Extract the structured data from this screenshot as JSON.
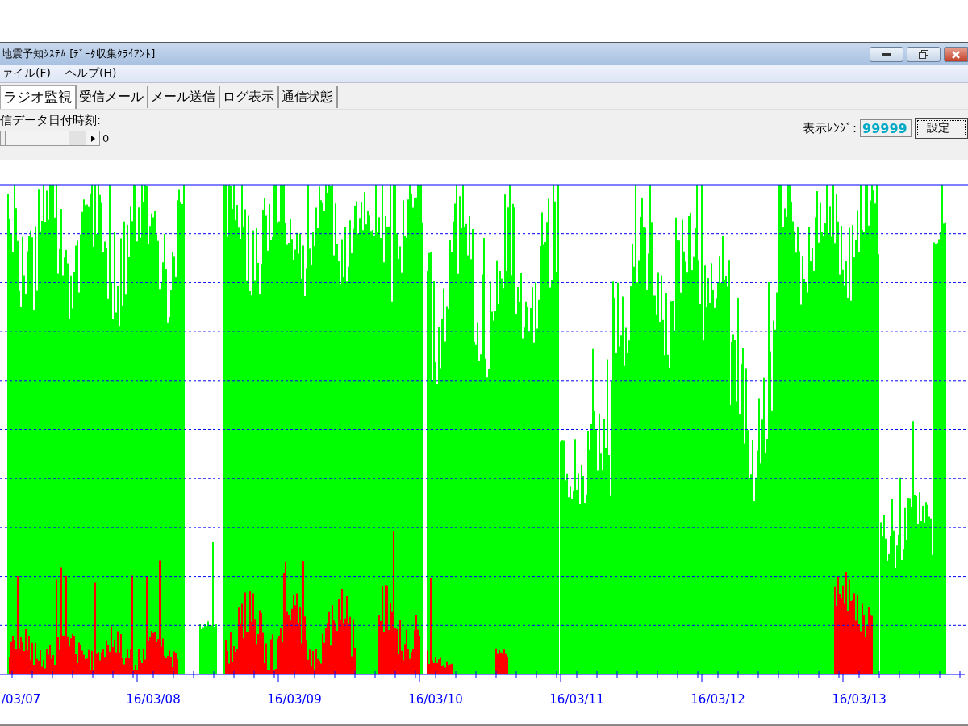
{
  "window": {
    "title": "地震予知ｼｽﾃﾑ [ﾃﾞｰﾀ収集ｸﾗｲｱﾝﾄ]"
  },
  "menu": [
    "ァイル(F)",
    "ヘルプ(H)"
  ],
  "tabs": [
    {
      "label": "ラジオ監視",
      "selected": true
    },
    {
      "label": "受信メール",
      "selected": false
    },
    {
      "label": "メール送信",
      "selected": false
    },
    {
      "label": "ログ表示",
      "selected": false
    },
    {
      "label": "通信状態",
      "selected": false
    }
  ],
  "controls": {
    "date_label": "信データ日付時刻:",
    "scroll_value": "0",
    "range_label": "表示ﾚﾝｼﾞ:",
    "range_value": "99999",
    "set_button": "設定"
  },
  "chart": {
    "x_labels": [
      "/03/07",
      "16/03/08",
      "16/03/09",
      "16/03/10",
      "16/03/11",
      "16/03/12",
      "16/03/13"
    ]
  }
}
